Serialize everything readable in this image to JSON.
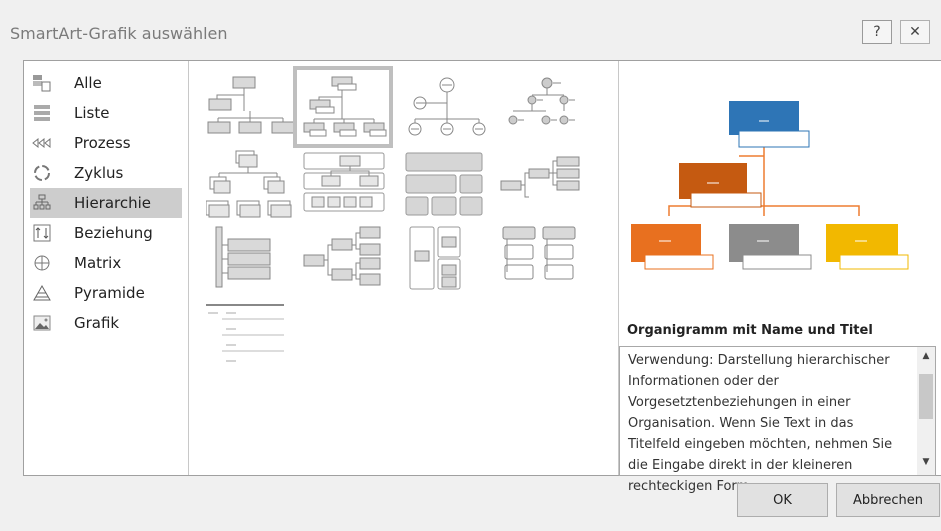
{
  "dialog": {
    "title": "SmartArt-Grafik auswählen",
    "help_icon": "?",
    "close_icon": "✕"
  },
  "categories": [
    {
      "label": "Alle",
      "icon": "all-icon",
      "selected": false
    },
    {
      "label": "Liste",
      "icon": "list-icon",
      "selected": false
    },
    {
      "label": "Prozess",
      "icon": "process-icon",
      "selected": false
    },
    {
      "label": "Zyklus",
      "icon": "cycle-icon",
      "selected": false
    },
    {
      "label": "Hierarchie",
      "icon": "hierarchy-icon",
      "selected": true
    },
    {
      "label": "Beziehung",
      "icon": "relationship-icon",
      "selected": false
    },
    {
      "label": "Matrix",
      "icon": "matrix-icon",
      "selected": false
    },
    {
      "label": "Pyramide",
      "icon": "pyramid-icon",
      "selected": false
    },
    {
      "label": "Grafik",
      "icon": "picture-icon",
      "selected": false
    }
  ],
  "preview": {
    "title": "Organigramm mit Name und Titel",
    "description": "Verwendung: Darstellung hierarchischer Informationen oder der Vorgesetztenbeziehungen in einer Organisation. Wenn Sie Text in das Titelfeld eingeben möchten, nehmen Sie die Eingabe direkt in der kleineren rechteckigen Form",
    "colors": {
      "top": "#2e75b6",
      "middle": "#c55a11",
      "left": "#e8701f",
      "center": "#8c8c8c",
      "right": "#f2b800",
      "lines": "#ed7d31"
    }
  },
  "buttons": {
    "ok": "OK",
    "cancel": "Abbrechen"
  }
}
